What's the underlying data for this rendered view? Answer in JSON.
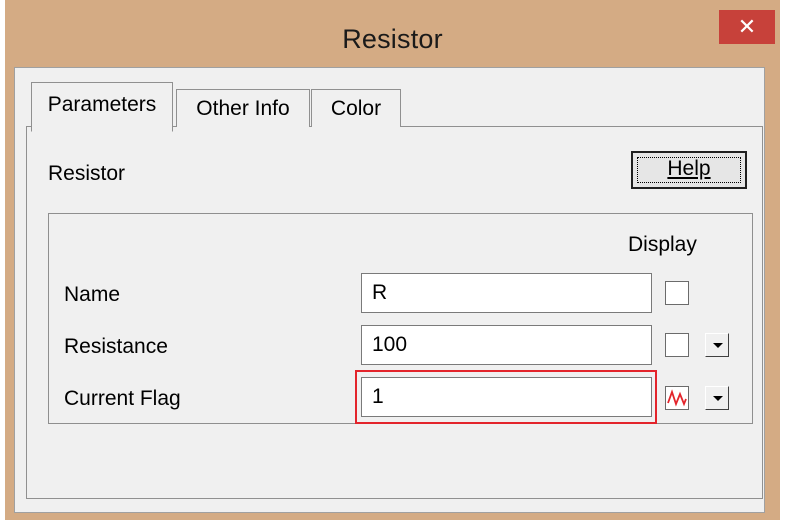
{
  "window": {
    "title": "Resistor",
    "close_label": "✕"
  },
  "tabs": [
    {
      "label": "Parameters",
      "active": true
    },
    {
      "label": "Other Info",
      "active": false
    },
    {
      "label": "Color",
      "active": false
    }
  ],
  "panel": {
    "heading": "Resistor",
    "help_label": "Help",
    "display_header": "Display",
    "rows": [
      {
        "label": "Name",
        "value": "R"
      },
      {
        "label": "Resistance",
        "value": "100"
      },
      {
        "label": "Current Flag",
        "value": "1"
      }
    ]
  },
  "colors": {
    "title_bar": "#d4ab84",
    "close_button": "#c7413a",
    "highlight": "#e3242b",
    "waveform": "#e3242b"
  },
  "icons": [
    "close-icon",
    "waveform-icon",
    "dropdown-arrow-icon"
  ]
}
